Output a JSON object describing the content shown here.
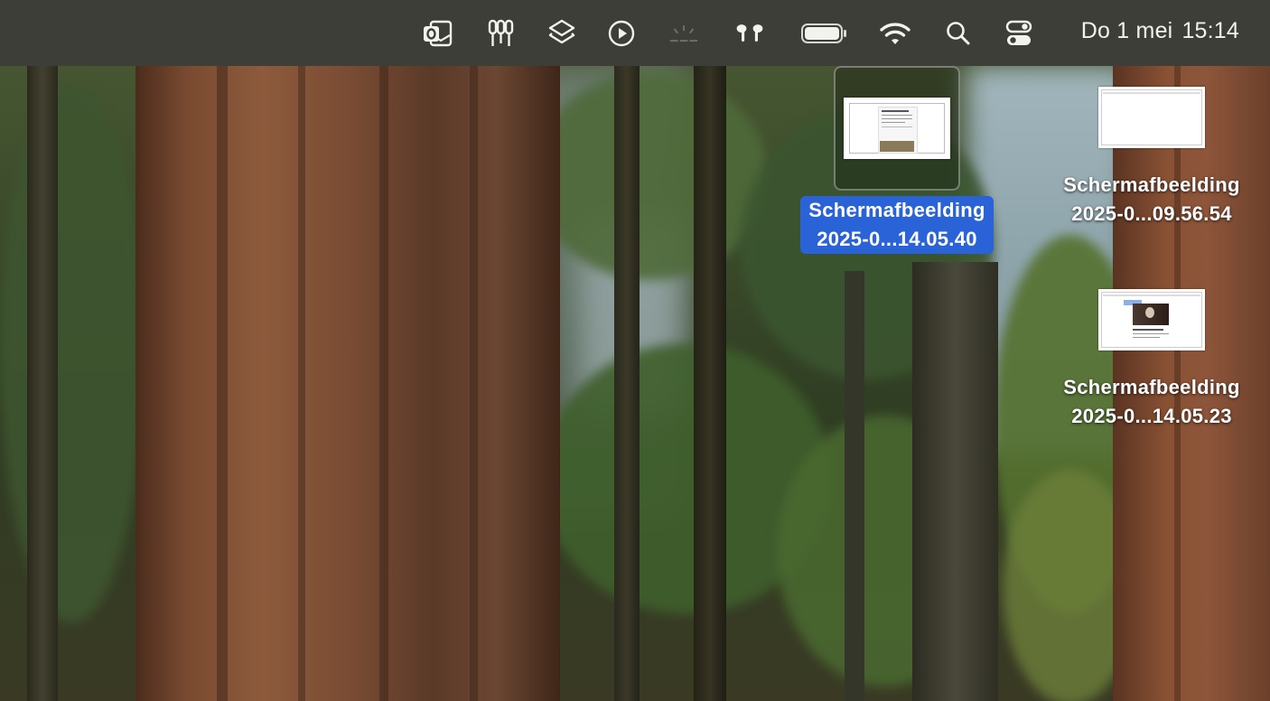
{
  "menubar": {
    "icons": [
      "outlook-icon",
      "keychain-icon",
      "layers-icon",
      "play-circle-icon",
      "brightness-icon",
      "airpods-icon",
      "battery-icon",
      "wifi-icon",
      "search-icon",
      "control-center-icon"
    ],
    "clock_day": "Do 1 mei",
    "clock_time": "15:14"
  },
  "desktop": {
    "items": [
      {
        "line1": "Schermafbeelding",
        "line2": "2025-0...14.05.40",
        "selected": true
      },
      {
        "line1": "Schermafbeelding",
        "line2": "2025-0...09.56.54",
        "selected": false
      },
      {
        "line1": "Schermafbeelding",
        "line2": "2025-0...14.05.23",
        "selected": false
      }
    ]
  },
  "colors": {
    "menubar_bg": "#3d3e38",
    "selection_blue": "#2a63d8"
  }
}
